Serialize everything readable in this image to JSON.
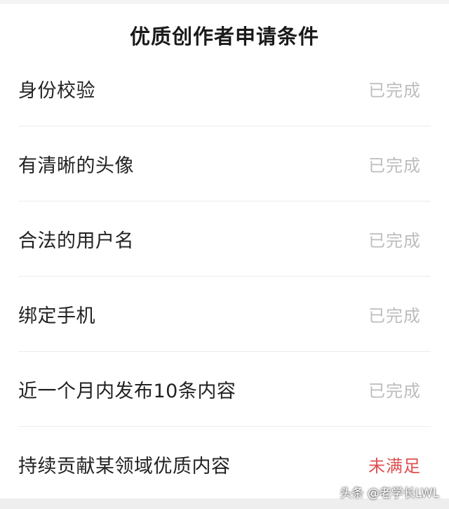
{
  "header": {
    "title": "优质创作者申请条件"
  },
  "conditions": [
    {
      "label": "身份校验",
      "status": "已完成"
    },
    {
      "label": "有清晰的头像",
      "status": "已完成"
    },
    {
      "label": "合法的用户名",
      "status": "已完成"
    },
    {
      "label": "绑定手机",
      "status": "已完成"
    },
    {
      "label": "近一个月内发布10条内容",
      "status": "已完成"
    },
    {
      "label": "持续贡献某领域优质内容",
      "status": "未满足"
    }
  ],
  "colors": {
    "completed": "#bdbdbd",
    "unmet": "#e05050"
  },
  "watermark": "头条 @老学长LWL"
}
